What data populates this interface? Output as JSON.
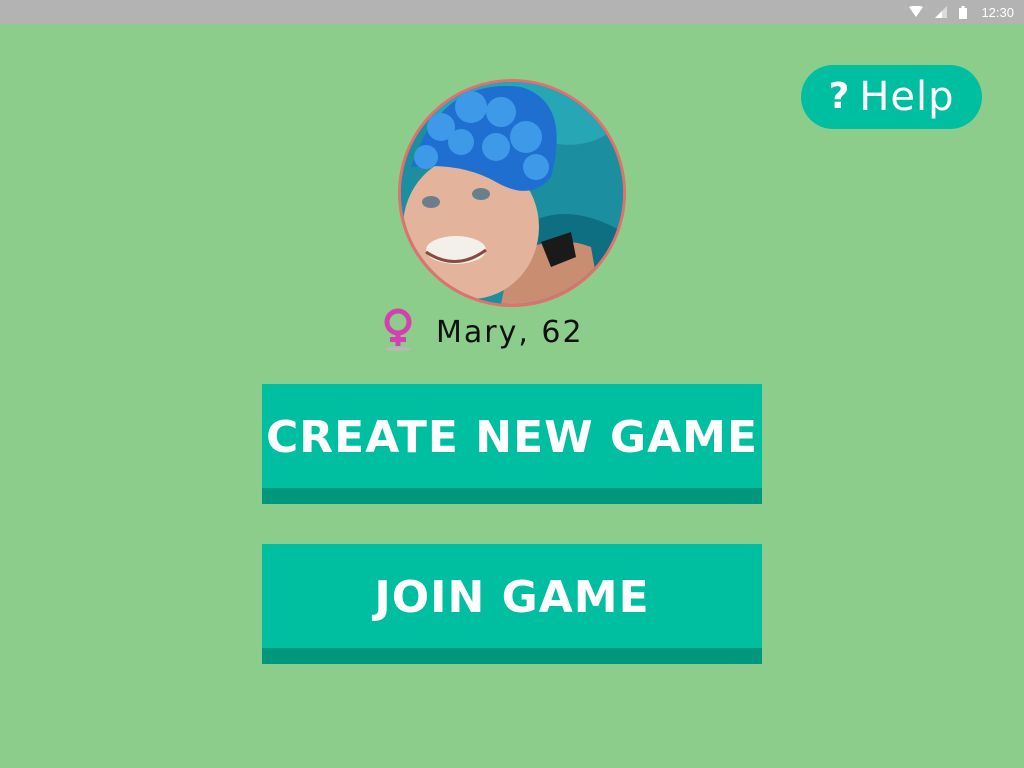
{
  "status_bar": {
    "time": "12:30",
    "icons": [
      "wifi-icon",
      "signal-icon",
      "battery-icon"
    ]
  },
  "help": {
    "symbol": "?",
    "label": "Help"
  },
  "profile": {
    "gender_icon": "female-symbol-icon",
    "name_age": "Mary, 62"
  },
  "actions": {
    "create_label": "CREATE NEW GAME",
    "join_label": "JOIN GAME"
  },
  "colors": {
    "background": "#8ccd8c",
    "accent": "#00bfa0",
    "accent_dark": "#00977f",
    "avatar_border": "#e2706d",
    "gender_icon": "#d63fb0"
  }
}
